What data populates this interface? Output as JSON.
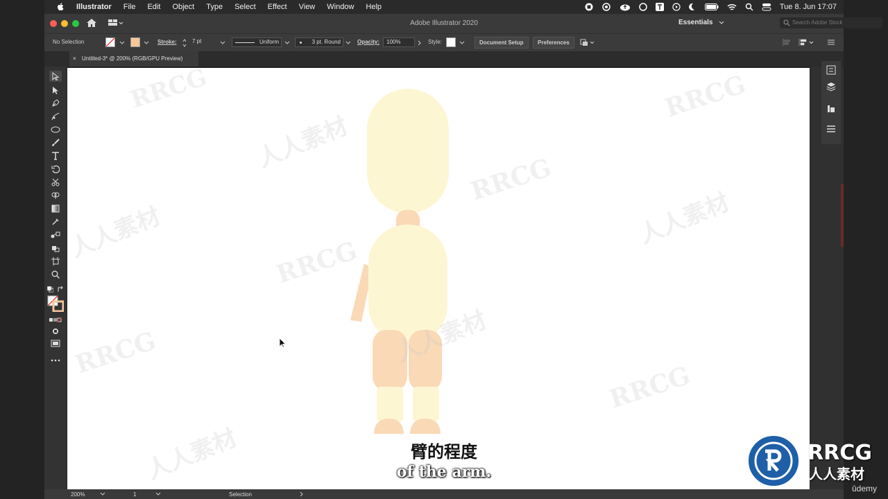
{
  "menubar": {
    "app_name": "Illustrator",
    "items": [
      "File",
      "Edit",
      "Object",
      "Type",
      "Select",
      "Effect",
      "View",
      "Window",
      "Help"
    ],
    "clock": "Tue 8. Jun  17:07"
  },
  "titlebar": {
    "title": "Adobe Illustrator 2020",
    "workspace": "Essentials",
    "search_placeholder": "Search Adobe Stock"
  },
  "controlbar": {
    "selection_status": "No Selection",
    "stroke_label": "Stroke:",
    "stroke_weight": "7 pt",
    "stroke_profile": "Uniform",
    "brush": "3 pt. Round",
    "opacity_label": "Opacity:",
    "opacity_value": "100%",
    "style_label": "Style:",
    "document_setup": "Document Setup",
    "preferences": "Preferences",
    "fill_color": "#f7c79a"
  },
  "document": {
    "tab_title": "Untitled-3* @ 200% (RGB/GPU Preview)"
  },
  "statusbar": {
    "zoom": "200%",
    "artboard": "1",
    "tool": "Selection"
  },
  "artwork": {
    "body_color": "#fdf6d2",
    "skin_color": "#f9d9b6"
  },
  "watermark": {
    "text_latin": "RRCG",
    "text_cn": "人人素材",
    "brand": "RRCG",
    "brand_cn": "人人素材",
    "udemy": "ûdemy"
  },
  "subtitles": {
    "chinese": "臂的程度",
    "english": "of the arm."
  }
}
